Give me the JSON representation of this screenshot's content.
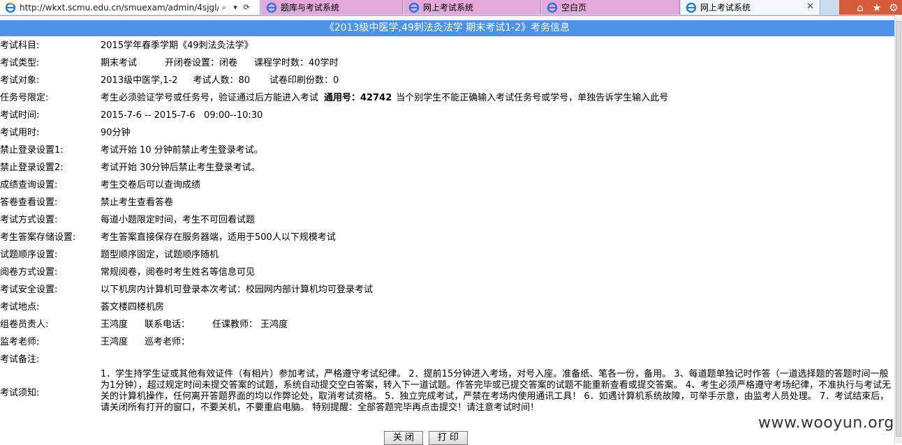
{
  "browser": {
    "url": "http://wkxt.scmu.edu.cn/smuexam/admin/4sjgl/e",
    "tabs": [
      {
        "label": "题库与考试系统"
      },
      {
        "label": "网上考试系统"
      },
      {
        "label": "空白页"
      },
      {
        "label": "网上考试系统"
      }
    ]
  },
  "page": {
    "title": "《2013级中医学,49刺法灸法学 期末考试1-2》考务信息"
  },
  "rows": [
    {
      "label": "考试科目:",
      "value": "2015学年春季学期《49刺法灸法学》"
    },
    {
      "label": "考试类型:",
      "value_parts": [
        "期末考试",
        "开闭卷设置：闭卷",
        "课程学时数：40学时"
      ]
    },
    {
      "label": "考试对象:",
      "value_parts": [
        "2013级中医学,1-2",
        "考试人数：80",
        "试卷印刷份数：0"
      ]
    },
    {
      "label": "任务号限定:",
      "value_a": "考生必须验证学号或任务号，验证通过后方能进入考试",
      "value_bold": "通用号：42742",
      "value_b": "当个别学生不能正确输入考试任务号或学号，单独告诉学生输入此号"
    },
    {
      "label": "考试时间:",
      "value": "2015-7-6 -- 2015-7-6   09:00--10:30"
    },
    {
      "label": "考试用时:",
      "value": "90分钟"
    },
    {
      "label": "禁止登录设置1:",
      "value": "考试开始 10 分钟前禁止考生登录考试。"
    },
    {
      "label": "禁止登录设置2:",
      "value": "考试开始 30分钟后禁止考生登录考试。"
    },
    {
      "label": "成绩查询设置:",
      "value": "考生交卷后可以查询成绩"
    },
    {
      "label": "答卷查看设置:",
      "value": "禁止考生查看答卷"
    },
    {
      "label": "考试方式设置:",
      "value": "每道小题限定时间，考生不可回看试题"
    },
    {
      "label": "考生答案存储设置:",
      "value": "考生答案直接保存在服务器端，适用于500人以下规模考试"
    },
    {
      "label": "试题顺序设置:",
      "value": "题型顺序固定，试题顺序随机"
    },
    {
      "label": "阅卷方式设置:",
      "value": "常规阅卷，阅卷时考生姓名等信息可见"
    },
    {
      "label": "考试安全设置:",
      "value": "以下机房内计算机可登录本次考试：校园网内部计算机均可登录考试"
    },
    {
      "label": "考试地点:",
      "value": "荟文楼四楼机房"
    },
    {
      "label": "组卷员责人:",
      "value_parts": [
        "王鸿度",
        "联系电话：",
        "任课教师：  王鸿度"
      ]
    },
    {
      "label": "监考老师:",
      "value_parts": [
        "王鸿度",
        "巡考老师："
      ]
    },
    {
      "label": "考试备注:",
      "value": ""
    },
    {
      "label": "考试须知:",
      "value": ""
    }
  ],
  "notice": "1．学生持学生证或其他有效证件（有相片）参加考试，严格遵守考试纪律。 2．提前15分钟进入考场，对号入座。准备纸、笔各一份，备用。 3、每道题单独记时作答（一道选择题的答题时间一般为1分钟），超过规定时间未提交答案的试题，系统自动提交空白答案，转入下一道试题。作答完毕或已提交答案的试题不能重新查看或提交答案。 4、考生必须严格遵守考场纪律，不准执行与考试无关的计算机操作，任何离开答题界面的均以作弊论处，取消考试资格。 5．独立完成考试，严禁在考场内使用通讯工具！ 6．如遇计算机系统故障，可举手示意，由监考人员处理。 7．考试结束后，请关闭所有打开的窗口，不要关机，不要重启电脑。 特别提醒：全部答题完毕再点击提交！请注意考试时间！",
  "buttons": {
    "close": "关 闭",
    "print": "打 印"
  },
  "watermark": "www.wooyun.org"
}
